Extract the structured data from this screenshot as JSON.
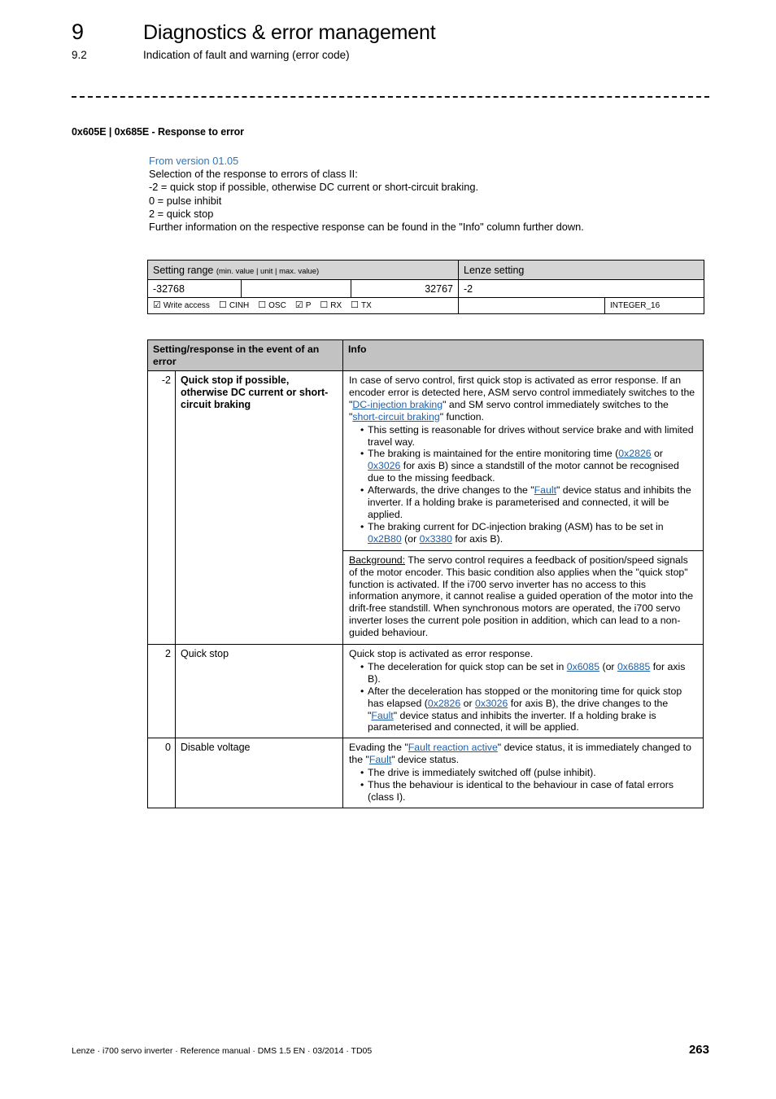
{
  "header": {
    "chapter_number": "9",
    "chapter_title": "Diagnostics & error management",
    "section_number": "9.2",
    "section_title": "Indication of fault and warning (error code)"
  },
  "parameter_heading": "0x605E | 0x685E - Response to error",
  "intro": {
    "version_note": "From version 01.05",
    "lines": [
      "Selection of the response to errors of class II:",
      "-2 = quick stop if possible, otherwise DC current or short-circuit braking.",
      "0 = pulse inhibit",
      "2 = quick stop",
      "Further information on the respective response can be found in the \"Info\" column further down."
    ]
  },
  "setting_range_table": {
    "header_main": "Setting range",
    "header_sub": "(min. value | unit | max. value)",
    "header_lenze": "Lenze setting",
    "min_value": "-32768",
    "unit_value": "",
    "max_value": "32767",
    "lenze_value": "-2",
    "access": [
      {
        "label": "Write access",
        "checked": true
      },
      {
        "label": "CINH",
        "checked": false
      },
      {
        "label": "OSC",
        "checked": false
      },
      {
        "label": "P",
        "checked": true
      },
      {
        "label": "RX",
        "checked": false
      },
      {
        "label": "TX",
        "checked": false
      }
    ],
    "checked_glyph": "☑",
    "unchecked_glyph": "☐",
    "data_type": "INTEGER_16"
  },
  "response_table": {
    "col_setting": "Setting/response in the event of an error",
    "col_info": "Info",
    "rows": [
      {
        "value": "-2",
        "label": "Quick stop if possible, otherwise DC current or short-circuit braking",
        "label_bold": true,
        "info_intro_a": "In case of servo control, first quick stop is activated as error response. If an encoder error is detected here, ASM servo control immediately switches to the \"",
        "link_dc": "DC-injection braking",
        "info_intro_b": "\" and SM servo control immediately switches to the \"",
        "link_sc": "short-circuit braking",
        "info_intro_c": "\" function.",
        "bullets": [
          {
            "text_a": "This setting is reasonable for drives without service brake and with limited travel way."
          },
          {
            "text_a": "The braking is maintained for the entire monitoring time (",
            "link1": "0x2826",
            "text_b": " or ",
            "link2": "0x3026",
            "text_c": " for axis B) since a standstill of the motor cannot be recognised due to the missing feedback."
          },
          {
            "text_a": "Afterwards, the drive changes to the \"",
            "link1": "Fault",
            "text_b": "\" device status and inhibits the inverter. If a holding brake is parameterised and connected, it will be applied."
          },
          {
            "text_a": "The braking current for DC-injection braking (ASM) has to be set in ",
            "link1": "0x2B80",
            "text_b": " (or ",
            "link2": "0x3380",
            "text_c": " for axis B)."
          }
        ],
        "background_label": "Background:",
        "background_text": " The servo control requires a feedback of position/speed signals of the motor encoder. This basic condition also applies when the \"quick stop\" function is activated. If the i700 servo inverter has no access to this information anymore, it cannot realise a guided operation of the motor into the drift-free standstill. When synchronous motors are operated, the i700 servo inverter loses the current pole position in addition, which can lead to a non-guided behaviour."
      },
      {
        "value": "2",
        "label": "Quick stop",
        "label_bold": false,
        "info_intro_a": "Quick stop is activated as error response.",
        "bullets": [
          {
            "text_a": "The deceleration for quick stop can be set in ",
            "link1": "0x6085",
            "text_b": " (or ",
            "link2": "0x6885",
            "text_c": " for axis B)."
          },
          {
            "text_a": "After the deceleration has stopped or the monitoring time for quick stop has elapsed (",
            "link1": "0x2826",
            "text_b": " or ",
            "link2": "0x3026",
            "text_c": " for axis B), the drive changes to the \"",
            "link3": "Fault",
            "text_d": "\" device status and inhibits the inverter. If a holding brake is parameterised and connected, it will be applied."
          }
        ]
      },
      {
        "value": "0",
        "label": "Disable voltage",
        "label_bold": false,
        "info_intro_a": "Evading the \"",
        "link_fra": "Fault reaction active",
        "info_intro_b": "\" device status, it is immediately changed to the \"",
        "link_fault": "Fault",
        "info_intro_c": "\" device status.",
        "bullets": [
          {
            "text_a": "The drive is immediately switched off (pulse inhibit)."
          },
          {
            "text_a": "Thus the behaviour is identical to the behaviour in case of fatal errors (class I)."
          }
        ]
      }
    ]
  },
  "footer": {
    "text": "Lenze · i700 servo inverter · Reference manual · DMS 1.5 EN · 03/2014 · TD05",
    "page_number": "263"
  },
  "colors": {
    "link": "#1f5fa9",
    "version_note": "#2e75b6",
    "table_header_light": "#d5d5d5",
    "table_header_dark": "#c2c2c2"
  }
}
